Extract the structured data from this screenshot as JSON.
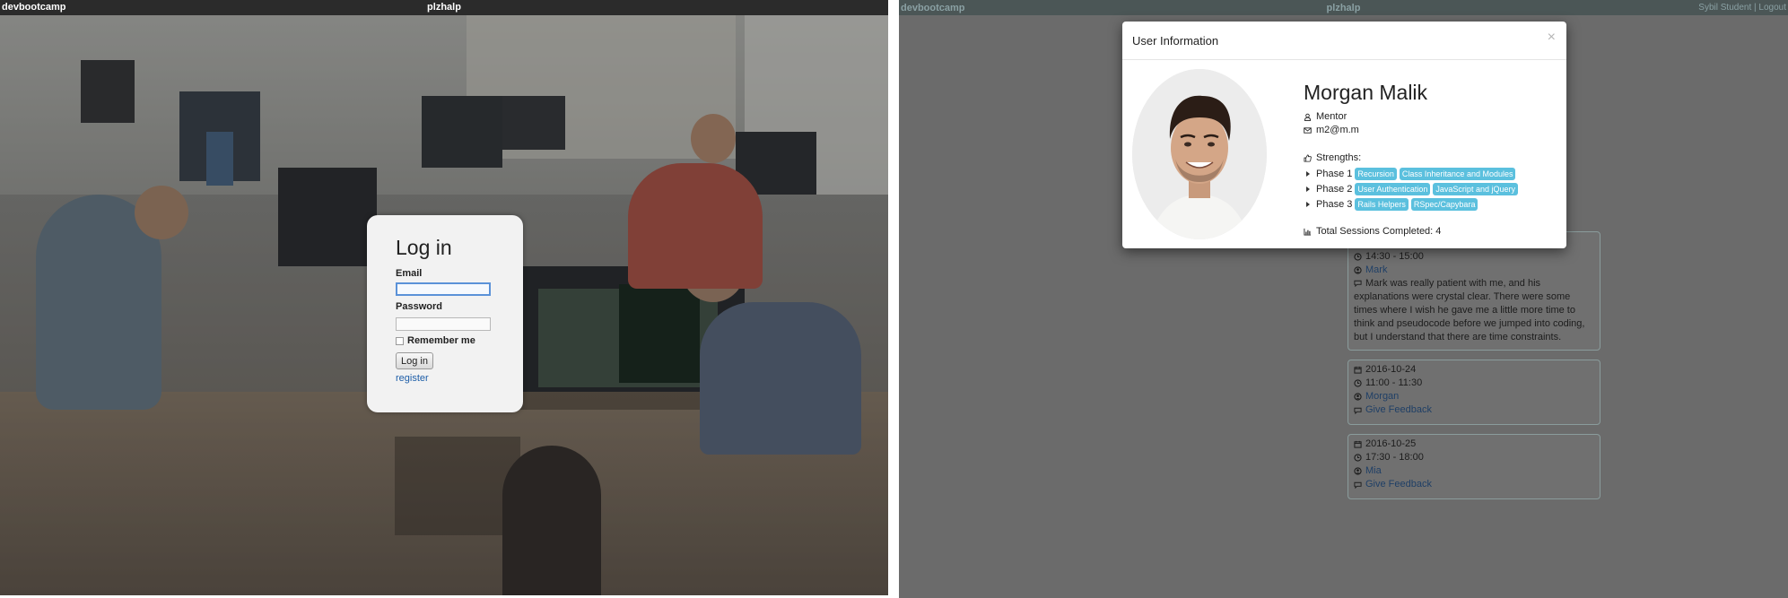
{
  "left": {
    "navbar": {
      "brand": "devbootcamp",
      "app_name": "plzhalp"
    },
    "login": {
      "title": "Log in",
      "email_label": "Email",
      "email_value": "",
      "password_label": "Password",
      "password_value": "",
      "remember_label": "Remember me",
      "submit_label": "Log in",
      "register_label": "register"
    }
  },
  "right": {
    "navbar": {
      "brand": "devbootcamp",
      "app_name": "plzhalp",
      "user": "Sybil Student",
      "separator": "|",
      "logout": "Logout"
    },
    "modal": {
      "title": "User Information",
      "close": "×",
      "name": "Morgan Malik",
      "role": "Mentor",
      "email": "m2@m.m",
      "strengths_label": "Strengths:",
      "phases": [
        {
          "label": "Phase 1",
          "tags": [
            "Recursion",
            "Class Inheritance and Modules"
          ]
        },
        {
          "label": "Phase 2",
          "tags": [
            "User Authentication",
            "JavaScript and jQuery"
          ]
        },
        {
          "label": "Phase 3",
          "tags": [
            "Rails Helpers",
            "RSpec/Capybara"
          ]
        }
      ],
      "sessions_text": "Total Sessions Completed: 4"
    },
    "sessions": [
      {
        "time": "14:30 - 15:00",
        "person": "Mark",
        "comment": "Mark was really patient with me, and his explanations were crystal clear. There were some times where I wish he gave me a little more time to think and pseudocode before we jumped into coding, but I understand that there are time constraints."
      },
      {
        "date": "2016-10-24",
        "time": "11:00 - 11:30",
        "person": "Morgan",
        "action": "Give Feedback"
      },
      {
        "date": "2016-10-25",
        "time": "17:30 - 18:00",
        "person": "Mia",
        "action": "Give Feedback"
      }
    ],
    "colors": {
      "badge": "#5bc0de",
      "link": "#1e5ea8",
      "overlay": "#6b6b6b"
    }
  }
}
